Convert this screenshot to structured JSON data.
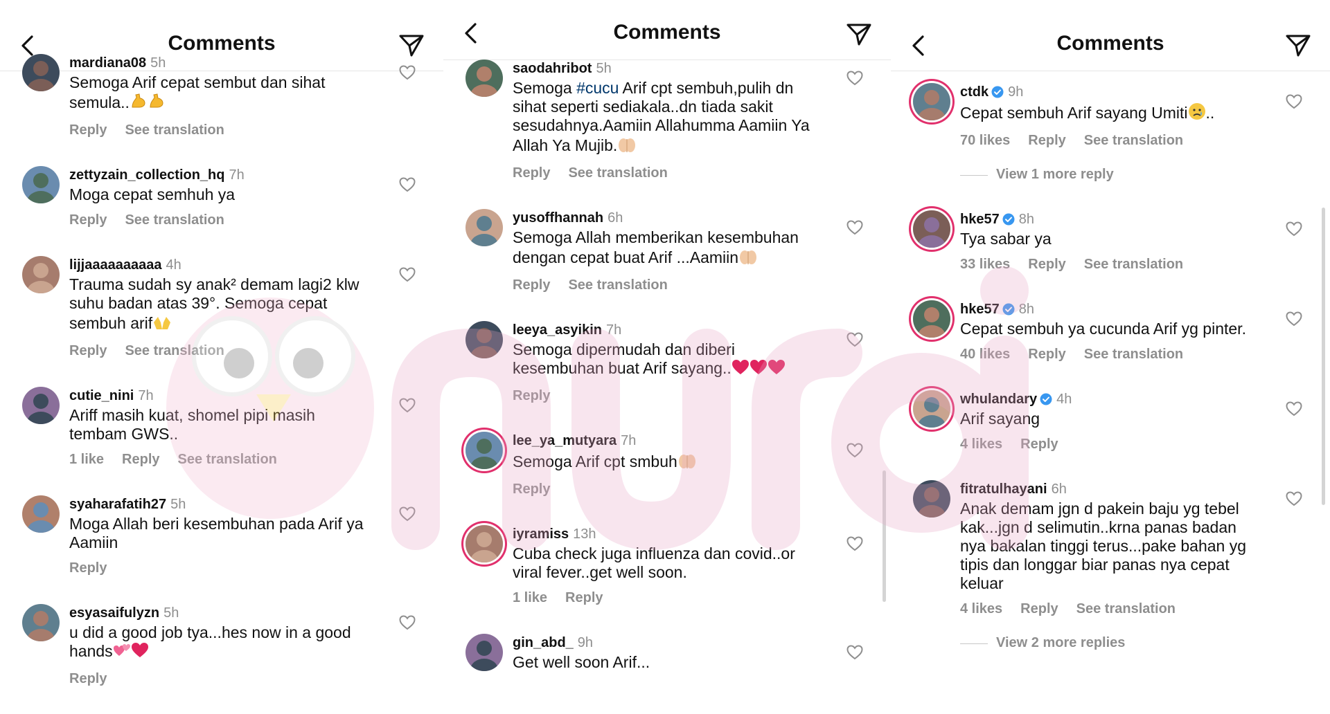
{
  "panels": [
    {
      "title": "Comments",
      "comments": [
        {
          "user": "mardiana08",
          "time": "5h",
          "text": "Semoga Arif cepat sembut dan sihat semula..",
          "emoji": [
            "muscle",
            "muscle"
          ],
          "meta": [
            "Reply",
            "See translation"
          ]
        },
        {
          "user": "zettyzain_collection_hq",
          "time": "7h",
          "text": "Moga cepat semhuh ya",
          "meta": [
            "Reply",
            "See translation"
          ]
        },
        {
          "user": "lijjaaaaaaaaaa",
          "time": "4h",
          "text": "Trauma sudah sy anak² demam lagi2 klw suhu badan atas 39°. Semoga cepat sembuh arif",
          "emoji": [
            "hands"
          ],
          "meta": [
            "Reply",
            "See translation"
          ]
        },
        {
          "user": "cutie_nini",
          "time": "7h",
          "text": "Ariff masih kuat, shomel pipi masih tembam GWS..",
          "meta": [
            "1 like",
            "Reply",
            "See translation"
          ]
        },
        {
          "user": "syaharafatih27",
          "time": "5h",
          "text": "Moga Allah beri kesembuhan pada Arif ya Aamiin",
          "meta": [
            "Reply"
          ]
        },
        {
          "user": "esyasaifulyzn",
          "time": "5h",
          "text": "u did a good job tya...hes now in a good hands",
          "emoji": [
            "hearts",
            "heart"
          ],
          "meta": [
            "Reply"
          ]
        }
      ]
    },
    {
      "title": "Comments",
      "comments": [
        {
          "user": "saodahribot",
          "time": "5h",
          "text_pre": "Semoga ",
          "tag": "#cucu",
          "text": " Arif cpt sembuh,pulih dn sihat seperti sediakala..dn tiada sakit sesudahnya.Aamiin Allahumma Aamiin Ya Allah Ya Mujib.",
          "emoji": [
            "pray"
          ],
          "meta": [
            "Reply",
            "See translation"
          ]
        },
        {
          "user": "yusoffhannah",
          "time": "6h",
          "text": "Semoga Allah memberikan kesembuhan dengan cepat buat Arif ...Aamiin",
          "emoji": [
            "pray"
          ],
          "meta": [
            "Reply",
            "See translation"
          ]
        },
        {
          "user": "leeya_asyikin",
          "time": "7h",
          "text": "Semoga dipermudah dan diberi kesembuhan buat Arif sayang..",
          "emoji": [
            "heart",
            "heart",
            "heart"
          ],
          "meta": [
            "Reply"
          ]
        },
        {
          "user": "lee_ya_mutyara",
          "time": "7h",
          "text": "Semoga Arif cpt smbuh",
          "emoji": [
            "pray"
          ],
          "meta": [
            "Reply"
          ]
        },
        {
          "user": "iyramiss",
          "time": "13h",
          "text": "Cuba check juga influenza dan covid..or viral fever..get well soon.",
          "meta": [
            "1 like",
            "Reply"
          ]
        },
        {
          "user": "gin_abd_",
          "time": "9h",
          "text": "Get well soon Arif...",
          "meta": []
        }
      ]
    },
    {
      "title": "Comments",
      "comments": [
        {
          "user": "ctdk",
          "verified": true,
          "time": "9h",
          "text": "Cepat sembuh Arif sayang Umiti",
          "emoji": [
            "cry"
          ],
          "text_post": "..",
          "meta": [
            "70 likes",
            "Reply",
            "See translation"
          ],
          "view_more": "View 1 more reply"
        },
        {
          "user": "hke57",
          "verified": true,
          "time": "8h",
          "text": "Tya sabar ya",
          "meta": [
            "33 likes",
            "Reply",
            "See translation"
          ]
        },
        {
          "user": "hke57",
          "verified": true,
          "time": "8h",
          "text": "Cepat sembuh ya cucunda Arif yg pinter.",
          "meta": [
            "40 likes",
            "Reply",
            "See translation"
          ]
        },
        {
          "user": "whulandary",
          "verified": true,
          "time": "4h",
          "text": "Arif sayang",
          "meta": [
            "4 likes",
            "Reply"
          ]
        },
        {
          "user": "fitratulhayani",
          "time": "6h",
          "text": "Anak demam jgn d pakein baju yg tebel kak...jgn d selimutin..krna panas badan nya bakalan tinggi terus...pake bahan yg tipis dan longgar biar panas nya cepat keluar",
          "meta": [
            "4 likes",
            "Reply",
            "See translation"
          ],
          "view_more": "View 2 more replies"
        }
      ]
    }
  ],
  "icons": {
    "back": "chevron-left-icon",
    "send": "paper-plane-icon",
    "like": "heart-outline-icon",
    "verified": "verified-badge-icon"
  },
  "colors": {
    "verified": "#3897f0",
    "story_ring": "#e1306c",
    "muted": "#8e8e8e",
    "hashtag": "#00376b",
    "emoji_heart": "#e0245e",
    "watermark": "#e7a6c6"
  }
}
